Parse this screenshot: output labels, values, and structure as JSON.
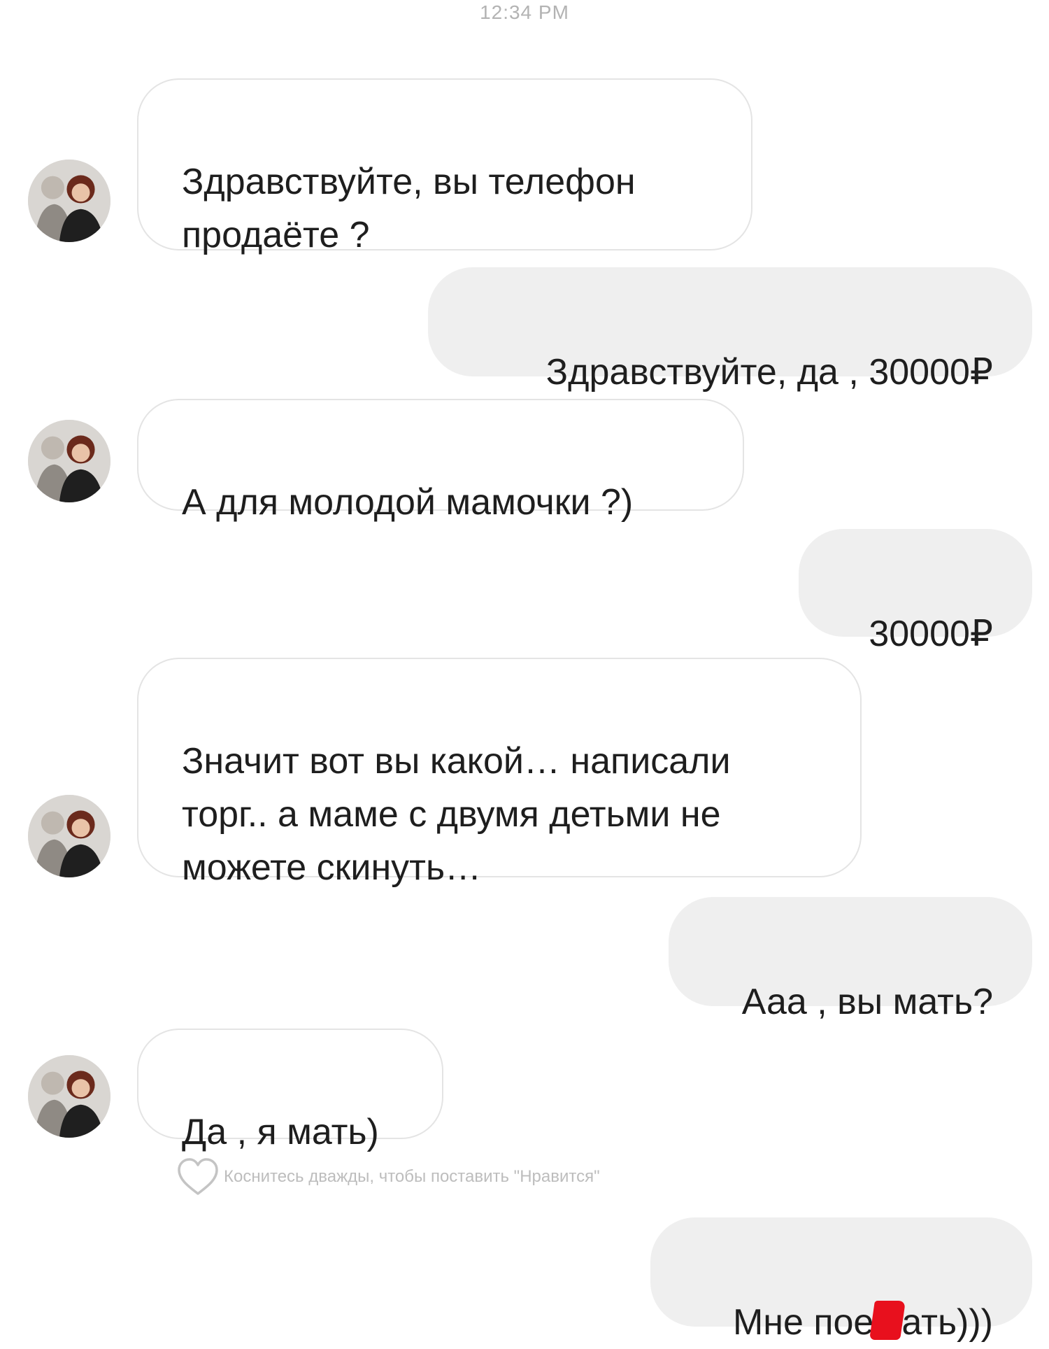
{
  "timestamp": "12:34 PM",
  "messages": [
    {
      "side": "in",
      "text": "Здравствуйте, вы телефон\nпродаёте ?"
    },
    {
      "side": "out",
      "text": "Здравствуйте, да , 30000₽"
    },
    {
      "side": "in",
      "text": "А для молодой мамочки ?)"
    },
    {
      "side": "out",
      "text": "30000₽"
    },
    {
      "side": "in",
      "text": "Значит вот вы какой… написали\nторг.. а маме с двумя детьми не\nможете скинуть…"
    },
    {
      "side": "out",
      "text": "Ааа , вы мать?"
    },
    {
      "side": "in",
      "text": "Да , я мать)"
    },
    {
      "side": "out",
      "text_before_censor": "Мне пое",
      "text_after_censor": "ать)))"
    }
  ],
  "like_hint": "Коснитесь дважды, чтобы поставить \"Нравится\"",
  "icons": {
    "avatar": "contact-avatar-photo",
    "like": "heart-outline-icon",
    "censor": "red-censor-mark"
  },
  "colors": {
    "background": "#ffffff",
    "incoming_bubble_border": "#e4e4e4",
    "outgoing_bubble": "#efefef",
    "censor_mark": "#e8101d"
  }
}
